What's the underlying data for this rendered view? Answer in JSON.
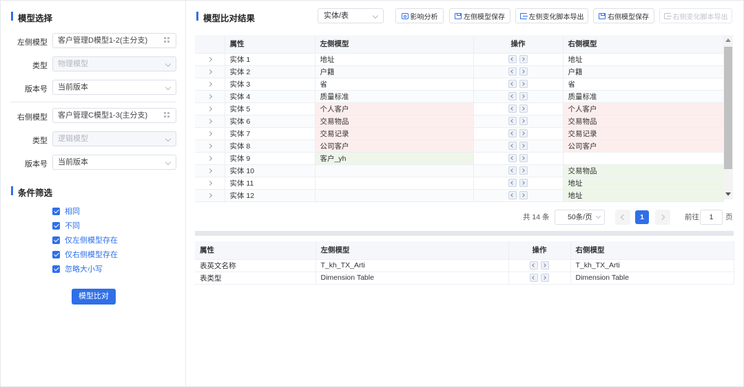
{
  "left_panel": {
    "model_select_title": "模型选择",
    "left_model": {
      "label": "左侧模型",
      "value": "客户管理D模型1-2(主分支)"
    },
    "left_type": {
      "label": "类型",
      "value": "物理模型"
    },
    "left_version": {
      "label": "版本号",
      "value": "当前版本"
    },
    "right_model": {
      "label": "右侧模型",
      "value": "客户管理C模型1-3(主分支)"
    },
    "right_type": {
      "label": "类型",
      "value": "逻辑模型"
    },
    "right_version": {
      "label": "版本号",
      "value": "当前版本"
    },
    "filter_title": "条件筛选",
    "filters": [
      {
        "label": "相同",
        "checked": true
      },
      {
        "label": "不同",
        "checked": true
      },
      {
        "label": "仅左侧模型存在",
        "checked": true
      },
      {
        "label": "仅右侧模型存在",
        "checked": true
      },
      {
        "label": "忽略大小写",
        "checked": true
      }
    ],
    "compare_button": "模型比对"
  },
  "right_panel": {
    "title": "模型比对结果",
    "scope_select": "实体/表",
    "toolbar": {
      "impact": "影响分析",
      "left_save": "左侧模型保存",
      "left_export": "左侧变化脚本导出",
      "right_save": "右侧模型保存",
      "right_export": "右侧变化脚本导出"
    },
    "table1": {
      "headers": [
        "属性",
        "左侧模型",
        "操作",
        "右侧模型"
      ],
      "rows": [
        {
          "attr": "实体 1",
          "left": "地址",
          "right": "地址",
          "status": "same"
        },
        {
          "attr": "实体 2",
          "left": "户籍",
          "right": "户籍",
          "status": "same"
        },
        {
          "attr": "实体 3",
          "left": "省",
          "right": "省",
          "status": "same"
        },
        {
          "attr": "实体 4",
          "left": "质量标准",
          "right": "质量标准",
          "status": "same"
        },
        {
          "attr": "实体 5",
          "left": "个人客户",
          "right": "个人客户",
          "status": "diff"
        },
        {
          "attr": "实体 6",
          "left": "交易物品",
          "right": "交易物品",
          "status": "diff"
        },
        {
          "attr": "实体 7",
          "left": "交易记录",
          "right": "交易记录",
          "status": "diff"
        },
        {
          "attr": "实体 8",
          "left": "公司客户",
          "right": "公司客户",
          "status": "diff"
        },
        {
          "attr": "实体 9",
          "left": "客户_yh",
          "right": "",
          "status": "left-only"
        },
        {
          "attr": "实体 10",
          "left": "",
          "right": "交易物品",
          "status": "right-only"
        },
        {
          "attr": "实体 11",
          "left": "",
          "right": "地址",
          "status": "right-only"
        },
        {
          "attr": "实体 12",
          "left": "",
          "right": "地址",
          "status": "right-only"
        }
      ]
    },
    "pagination": {
      "total": "共 14 条",
      "page_size": "50条/页",
      "current_page": "1",
      "goto_label": "前往",
      "goto_value": "1",
      "page_unit": "页"
    },
    "table2": {
      "headers": [
        "属性",
        "左侧模型",
        "操作",
        "右侧模型"
      ],
      "rows": [
        {
          "attr": "表英文名称",
          "left": "T_kh_TX_Arti",
          "right": "T_kh_TX_Arti"
        },
        {
          "attr": "表类型",
          "left": "Dimension Table",
          "right": "Dimension Table"
        }
      ]
    }
  },
  "colors": {
    "accent": "#2f6fe8",
    "diff_bg": "#fdeeee",
    "only_bg": "#eef6ea"
  }
}
